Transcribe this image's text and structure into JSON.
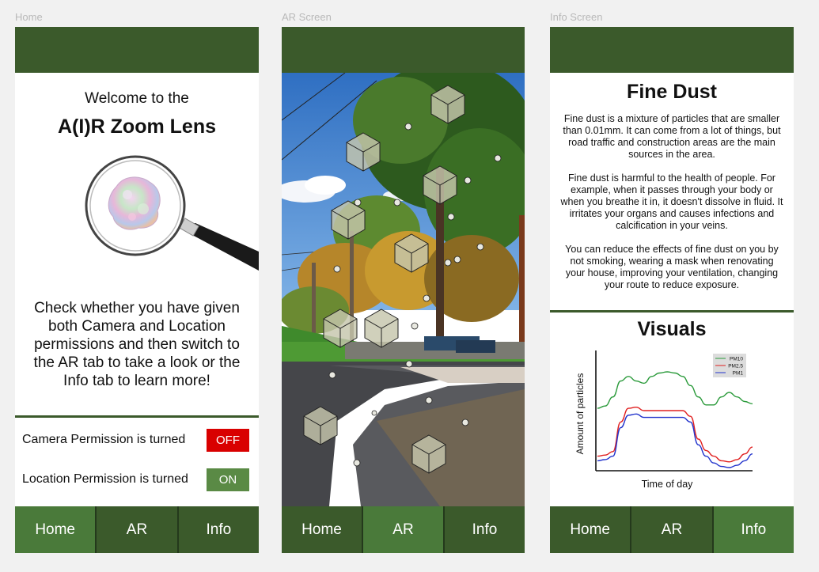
{
  "screens": {
    "home": {
      "label": "Home"
    },
    "ar": {
      "label": "AR Screen"
    },
    "info": {
      "label": "Info Screen"
    }
  },
  "nav": {
    "home": "Home",
    "ar": "AR",
    "info": "Info"
  },
  "home": {
    "welcome": "Welcome to the",
    "title": "A(I)R Zoom Lens",
    "instructions": "Check whether you have given both Camera and Location permissions and then switch to the AR tab to take a look or the Info tab to learn more!",
    "camera_permission": {
      "label": "Camera Permission is turned",
      "state": "OFF"
    },
    "location_permission": {
      "label": "Location Permission is turned",
      "state": "ON"
    }
  },
  "info": {
    "title": "Fine Dust",
    "para1": "Fine dust is a mixture of particles that are smaller than 0.01mm. It can come from a lot of things, but road traffic and construction areas are the main sources in the area.",
    "para2": "Fine dust is harmful to the health of people. For example, when it passes through your body or when you breathe it in, it doesn't dissolve in fluid. It irritates your organs and causes infections and calcification in your veins.",
    "para3": "You can reduce the effects of fine dust on you by not smoking, wearing a mask when renovating your house, improving your ventilation, changing your route to reduce exposure.",
    "visuals_title": "Visuals"
  },
  "colors": {
    "header": "#3b5a2b",
    "nav_active": "#4a7a3a",
    "off": "#d90000",
    "on": "#5a8a45"
  },
  "chart_data": {
    "type": "line",
    "xlabel": "Time of day",
    "ylabel": "Amount of particles",
    "x": [
      0,
      1,
      2,
      3,
      4,
      5,
      6,
      7,
      8,
      9,
      10,
      11,
      12,
      13,
      14,
      15,
      16,
      17,
      18,
      19,
      20
    ],
    "series": [
      {
        "name": "PM10",
        "color": "#2a9a3a",
        "values": [
          52,
          54,
          62,
          76,
          80,
          76,
          74,
          80,
          83,
          84,
          83,
          80,
          72,
          62,
          55,
          55,
          62,
          66,
          62,
          58,
          56
        ]
      },
      {
        "name": "PM2.5",
        "color": "#e02020",
        "values": [
          10,
          11,
          14,
          40,
          52,
          53,
          50,
          50,
          50,
          50,
          50,
          50,
          45,
          25,
          15,
          10,
          6,
          5,
          7,
          12,
          18
        ]
      },
      {
        "name": "PM1",
        "color": "#2233cc",
        "values": [
          6,
          7,
          10,
          35,
          46,
          47,
          44,
          44,
          44,
          44,
          44,
          44,
          40,
          20,
          10,
          4,
          1,
          0,
          2,
          6,
          12
        ]
      }
    ],
    "ylim": [
      0,
      100
    ],
    "grid": false,
    "legend": "top-right"
  }
}
